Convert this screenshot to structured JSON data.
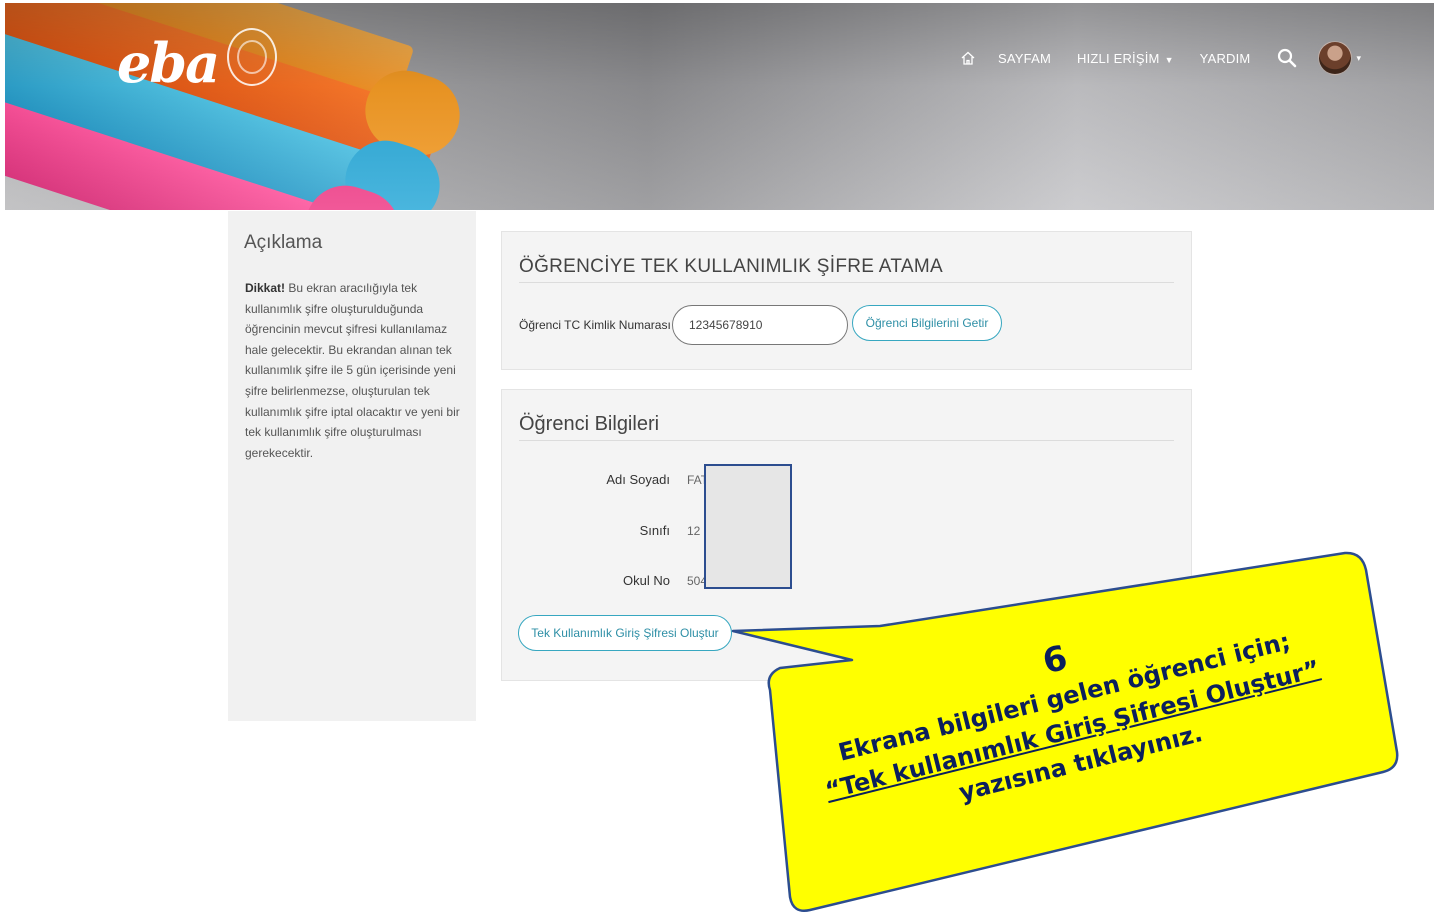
{
  "header": {
    "logo_text": "eba",
    "nav": {
      "sayfam": "SAYFAM",
      "hizli_erisim": "HIZLI ERİŞİM",
      "yardim": "YARDIM"
    }
  },
  "sidebar": {
    "title": "Açıklama",
    "warning_prefix": "Dikkat!",
    "text": " Bu ekran aracılığıyla tek kullanımlık şifre oluşturulduğunda öğrencinin mevcut şifresi kullanılamaz hale gelecektir. Bu ekrandan alınan tek kullanımlık şifre ile 5 gün içerisinde yeni şifre belirlenmezse, oluşturulan tek kullanımlık şifre iptal olacaktır ve yeni bir tek kullanımlık şifre oluşturulması gerekecektir."
  },
  "assign_panel": {
    "title": "ÖĞRENCİYE TEK KULLANIMLIK ŞİFRE ATAMA",
    "tc_label": "Öğrenci TC Kimlik Numarası",
    "tc_value": "12345678910",
    "fetch_button": "Öğrenci Bilgilerini Getir"
  },
  "student_panel": {
    "title": "Öğrenci Bilgileri",
    "fields": [
      {
        "label": "Adı Soyadı",
        "value": "FAT"
      },
      {
        "label": "Sınıfı",
        "value": "12"
      },
      {
        "label": "Okul No",
        "value": "504"
      }
    ],
    "create_button": "Tek Kullanımlık Giriş Şifresi Oluştur"
  },
  "callout": {
    "step": "6",
    "line1": "Ekrana bilgileri gelen öğrenci için;",
    "link_text": "“Tek kullanımlık Giriş Şifresi Oluştur”",
    "line_end": " yazısına tıklayınız.",
    "fill_color": "#ffff00",
    "border_color": "#2c4d8f"
  }
}
